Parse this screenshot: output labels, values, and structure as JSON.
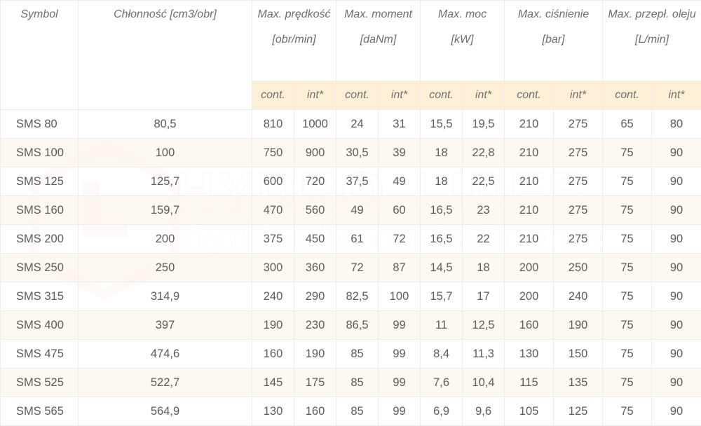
{
  "watermark": {
    "brand_a": "HYDRO",
    "brand_b": "LIDER",
    "tagline": "hydraulic components"
  },
  "header": {
    "symbol": "Symbol",
    "displacement": {
      "line1": "Chłonność",
      "line2": "[cm3/obr]"
    },
    "groups": [
      {
        "line1": "Max. prędkość",
        "line2": "[obr/min]"
      },
      {
        "line1": "Max. moment",
        "line2": "[daNm]"
      },
      {
        "line1": "Max. moc",
        "line2": "[kW]"
      },
      {
        "line1": "Max. ciśnienie",
        "line2": "[bar]"
      },
      {
        "line1": "Max. przepł. oleju",
        "line2": "[L/min]"
      }
    ],
    "sub": {
      "cont": "cont.",
      "int": "int*"
    }
  },
  "rows": [
    [
      "SMS 80",
      "80,5",
      "810",
      "1000",
      "24",
      "31",
      "15,5",
      "19,5",
      "210",
      "275",
      "65",
      "80"
    ],
    [
      "SMS 100",
      "100",
      "750",
      "900",
      "30,5",
      "39",
      "18",
      "22,8",
      "210",
      "275",
      "75",
      "90"
    ],
    [
      "SMS 125",
      "125,7",
      "600",
      "720",
      "37,5",
      "49",
      "18",
      "22,5",
      "210",
      "275",
      "75",
      "90"
    ],
    [
      "SMS 160",
      "159,7",
      "470",
      "560",
      "49",
      "60",
      "16,5",
      "23",
      "210",
      "275",
      "75",
      "90"
    ],
    [
      "SMS 200",
      "200",
      "375",
      "450",
      "61",
      "72",
      "16,5",
      "22",
      "210",
      "275",
      "75",
      "90"
    ],
    [
      "SMS 250",
      "250",
      "300",
      "360",
      "72",
      "87",
      "14,5",
      "18",
      "200",
      "250",
      "75",
      "90"
    ],
    [
      "SMS 315",
      "314,9",
      "240",
      "290",
      "82,5",
      "100",
      "15,7",
      "17",
      "200",
      "240",
      "75",
      "90"
    ],
    [
      "SMS 400",
      "397",
      "190",
      "230",
      "86,5",
      "99",
      "11",
      "12,5",
      "160",
      "190",
      "75",
      "90"
    ],
    [
      "SMS 475",
      "474,6",
      "160",
      "190",
      "85",
      "99",
      "8,4",
      "11,3",
      "130",
      "150",
      "75",
      "90"
    ],
    [
      "SMS 525",
      "522,7",
      "145",
      "175",
      "85",
      "99",
      "7,6",
      "10,4",
      "115",
      "135",
      "75",
      "90"
    ],
    [
      "SMS 565",
      "564,9",
      "130",
      "160",
      "85",
      "99",
      "6,9",
      "9,6",
      "105",
      "125",
      "75",
      "90"
    ]
  ]
}
